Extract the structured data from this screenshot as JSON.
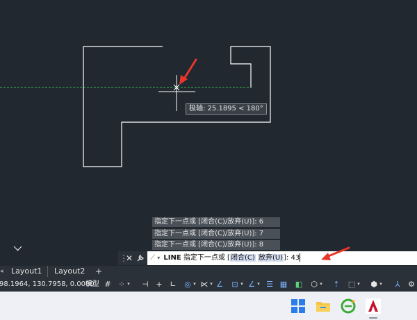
{
  "canvas": {
    "tooltip_text": "极轴: 25.1895 < 180°"
  },
  "command": {
    "history": [
      "指定下一点或 [闭合(C)/放弃(U)]: 6",
      "指定下一点或 [闭合(C)/放弃(U)]: 7",
      "指定下一点或 [闭合(C)/放弃(U)]: 8"
    ],
    "close_label": "✕",
    "customize_icon": "wrench-icon",
    "line_keyword": "LINE",
    "prompt_text": "指定下一点或 [",
    "option_close": "闭合(C)",
    "option_undo": "放弃(U)",
    "prompt_suffix": "]: ",
    "input_value": "43"
  },
  "layout_tabs": [
    "Layout1",
    "Layout2"
  ],
  "add_tab_label": "+",
  "status_bar": {
    "coordinates": "98.1964, 130.7958, 0.0000",
    "model_label": "模型"
  },
  "taskbar_icons": [
    "windows-start-icon",
    "file-explorer-icon",
    "browser-icon",
    "autocad-icon"
  ],
  "colors": {
    "canvas_bg": "#212830",
    "polar_tracking": "#3cb44b",
    "geometry": "#ffffff",
    "annotation_arrow": "#e8362b",
    "status_bg": "#2b3139",
    "taskbar_bg": "#eef0f5",
    "autocad_red": "#c8102e"
  }
}
